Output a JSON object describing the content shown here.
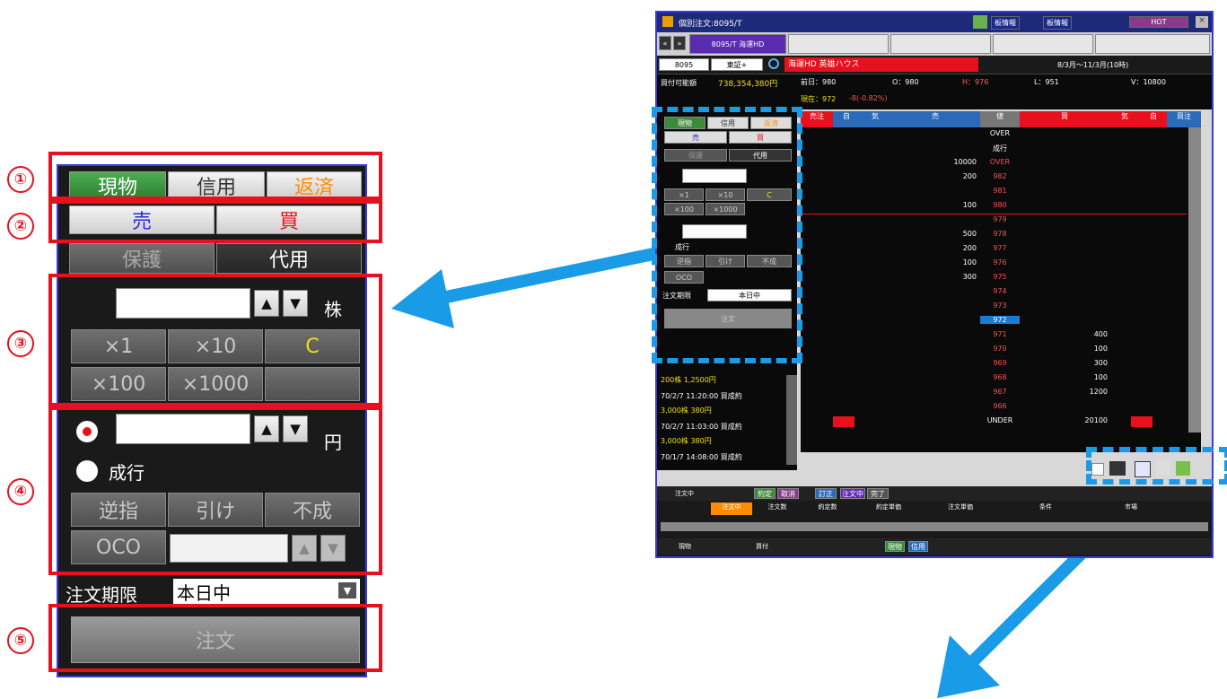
{
  "labels": {
    "n1": "①",
    "n2": "②",
    "n3": "③",
    "n4": "④",
    "n5": "⑤"
  },
  "colors": {
    "annotation_red": "#e8101c",
    "arrow_blue": "#1a9be8",
    "green": "#2e7d32",
    "orange": "#ff8c00"
  },
  "panel": {
    "tabs": {
      "spot": "現物",
      "margin": "信用",
      "repay": "返済"
    },
    "side": {
      "sell": "売",
      "buy": "買"
    },
    "collateral": {
      "protect": "保護",
      "substitute": "代用"
    },
    "qty": {
      "unit": "株",
      "up": "▲",
      "down": "▼",
      "x1": "×1",
      "x10": "×10",
      "clear": "C",
      "x100": "×100",
      "x1000": "×1000"
    },
    "price": {
      "unit": "円",
      "market_label": "成行",
      "stop": "逆指",
      "close": "引け",
      "no_exec": "不成",
      "oco": "OCO"
    },
    "expiry": {
      "label": "注文期限",
      "value": "本日中"
    },
    "order_button": "注文"
  },
  "window": {
    "title": "個別注文:8095/T",
    "title_btns": [
      "板情報",
      "板情報",
      "HOT"
    ],
    "tab": "8095/T 海運HD",
    "code": "8095",
    "market": "東証+",
    "stock_name": "海運HD 英雄ハウス",
    "date_range": "8/3月〜11/3月(10時)",
    "buying_power_label": "買付可能額",
    "buying_power": "738,354,380円",
    "quote": {
      "prev": "前日：980",
      "open": "O：980",
      "high": "H：976",
      "low": "L：951",
      "volume": "V：10800"
    },
    "current": "現在：972",
    "change": "-8(-0.82%)",
    "board_headers": [
      "売注",
      "自",
      "気",
      "売",
      "値",
      "買",
      "気",
      "自",
      "買注"
    ],
    "board_rows": [
      {
        "sell": "",
        "price": "OVER",
        "buy": ""
      },
      {
        "sell": "",
        "price": "成行",
        "buy": ""
      },
      {
        "sell": "10000",
        "price": "OVER",
        "buy": ""
      },
      {
        "sell": "200",
        "price": "982",
        "buy": ""
      },
      {
        "sell": "",
        "price": "981",
        "buy": ""
      },
      {
        "sell": "100",
        "price": "980",
        "buy": ""
      },
      {
        "sell": "",
        "price": "979",
        "buy": ""
      },
      {
        "sell": "500",
        "price": "978",
        "buy": ""
      },
      {
        "sell": "200",
        "price": "977",
        "buy": ""
      },
      {
        "sell": "100",
        "price": "976",
        "buy": ""
      },
      {
        "sell": "300",
        "price": "975",
        "buy": ""
      },
      {
        "sell": "",
        "price": "974",
        "buy": ""
      },
      {
        "sell": "",
        "price": "973",
        "buy": ""
      },
      {
        "sell": "",
        "price": "972",
        "buy": ""
      },
      {
        "sell": "",
        "price": "971",
        "buy": "400"
      },
      {
        "sell": "",
        "price": "970",
        "buy": "100"
      },
      {
        "sell": "",
        "price": "969",
        "buy": "300"
      },
      {
        "sell": "",
        "price": "968",
        "buy": "100"
      },
      {
        "sell": "",
        "price": "967",
        "buy": "1200"
      },
      {
        "sell": "",
        "price": "966",
        "buy": ""
      },
      {
        "sell": "",
        "price": "UNDER",
        "buy": "20100"
      }
    ],
    "history": [
      "200株 1,2500円",
      "70/2/7 11:20:00 買成約",
      "3,000株 380円",
      "70/2/7 11:03:00 買成約",
      "3,000株 380円",
      "70/1/7 14:08:00 買成約"
    ],
    "bottom_tabs": [
      "注文中",
      "約定",
      "取消",
      "訂正",
      "注文中",
      "約定",
      "完了"
    ],
    "bottom_cols": [
      "注文中",
      "注文数",
      "約定数",
      "約定単価",
      "注文単価",
      "条件",
      "市場"
    ],
    "footer": [
      "現物",
      "買付",
      "現物",
      "信用"
    ]
  }
}
